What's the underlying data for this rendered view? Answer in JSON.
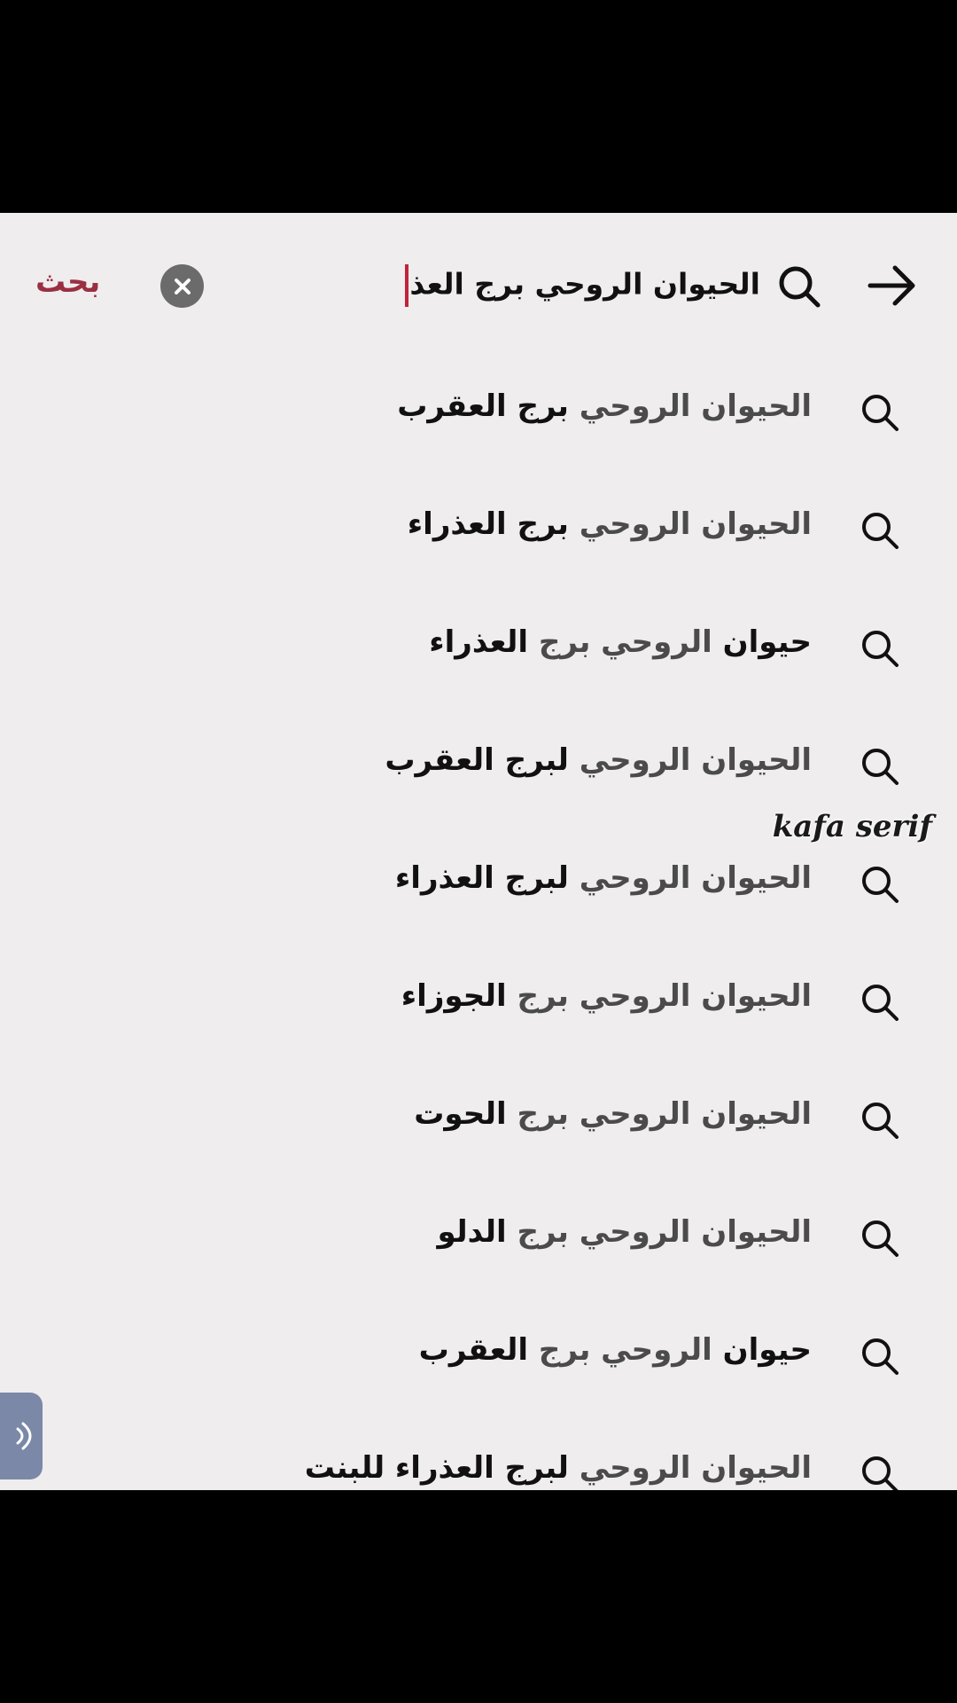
{
  "search": {
    "query_typed": "الحيوان الروحي برج العذ",
    "submit_label": "بحث",
    "back_icon": "arrow-right-icon",
    "clear_icon": "close-icon",
    "accent_color": "#9a2f42",
    "caret_color": "#c0243a"
  },
  "suggestions": [
    {
      "dim": "الحيوان الروحي ",
      "bold": "برج العقرب"
    },
    {
      "dim": "الحيوان الروحي ",
      "bold": "برج العذراء"
    },
    {
      "bold_start": "حيوان",
      "dim": " الروحي برج ",
      "bold": "العذراء"
    },
    {
      "dim": "الحيوان الروحي ",
      "bold": "لبرج العقرب"
    },
    {
      "dim": "الحيوان الروحي ",
      "bold": "لبرج العذراء"
    },
    {
      "dim": "الحيوان الروحي برج ",
      "bold": "الجوزاء"
    },
    {
      "dim": "الحيوان الروحي برج ",
      "bold": "الحوت"
    },
    {
      "dim": "الحيوان الروحي برج ",
      "bold": "الدلو"
    },
    {
      "bold_start": "حيوان",
      "dim": " الروحي برج ",
      "bold": "العقرب"
    },
    {
      "dim": "الحيوان الروحي ",
      "bold": "لبرج العذراء للبنت"
    }
  ],
  "watermark": "kafa serif",
  "background_color": "#efeded"
}
